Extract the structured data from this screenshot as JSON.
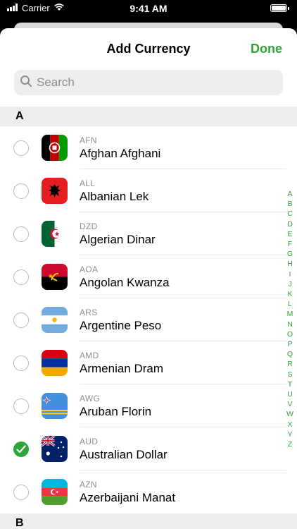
{
  "status_bar": {
    "carrier": "Carrier",
    "time": "9:41 AM"
  },
  "nav": {
    "title": "Add Currency",
    "done_label": "Done"
  },
  "search": {
    "placeholder": "Search"
  },
  "sections": [
    {
      "letter": "A"
    },
    {
      "letter": "B"
    }
  ],
  "currencies": [
    {
      "code": "AFN",
      "name": "Afghan Afghani",
      "flag": "afghanistan-flag",
      "selected": false
    },
    {
      "code": "ALL",
      "name": "Albanian Lek",
      "flag": "albania-flag",
      "selected": false
    },
    {
      "code": "DZD",
      "name": "Algerian Dinar",
      "flag": "algeria-flag",
      "selected": false
    },
    {
      "code": "AOA",
      "name": "Angolan Kwanza",
      "flag": "angola-flag",
      "selected": false
    },
    {
      "code": "ARS",
      "name": "Argentine Peso",
      "flag": "argentina-flag",
      "selected": false
    },
    {
      "code": "AMD",
      "name": "Armenian Dram",
      "flag": "armenia-flag",
      "selected": false
    },
    {
      "code": "AWG",
      "name": "Aruban Florin",
      "flag": "aruba-flag",
      "selected": false
    },
    {
      "code": "AUD",
      "name": "Australian Dollar",
      "flag": "australia-flag",
      "selected": true
    },
    {
      "code": "AZN",
      "name": "Azerbaijani Manat",
      "flag": "azerbaijan-flag",
      "selected": false
    }
  ],
  "index_letters": [
    "A",
    "B",
    "C",
    "D",
    "E",
    "F",
    "G",
    "H",
    "I",
    "J",
    "K",
    "L",
    "M",
    "N",
    "O",
    "P",
    "Q",
    "R",
    "S",
    "T",
    "U",
    "V",
    "W",
    "X",
    "Y",
    "Z"
  ],
  "colors": {
    "accent": "#2ea43a",
    "secondary_text": "#8e8e93",
    "section_bg": "#ededee"
  }
}
